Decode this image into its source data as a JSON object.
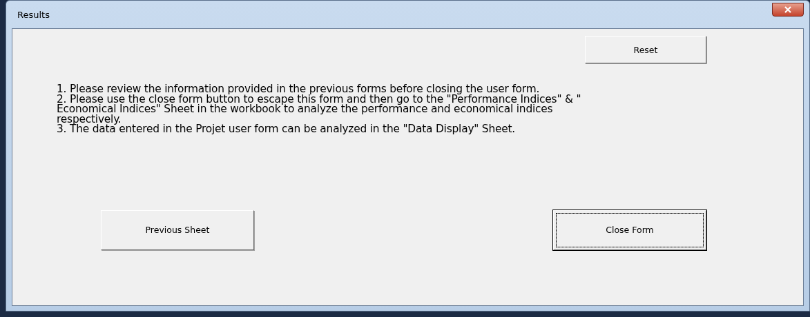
{
  "window": {
    "title": "Results"
  },
  "reset_button": {
    "label": "Reset",
    "focused": false
  },
  "instructions": [
    "1. Please review the information provided in the previous forms before closing the user form.",
    "2. Please use the close form button to escape this form and then go to the \"Performance Indices\" & \" Economical Indices\" Sheet in the workbook to analyze the performance and economical indices respectively.",
    "3. The data entered in the Projet user form can be analyzed in the \"Data Display\" Sheet."
  ],
  "buttons": [
    {
      "label": "Previous Sheet",
      "focused": false
    },
    {
      "label": "Close Form",
      "focused": true
    }
  ]
}
